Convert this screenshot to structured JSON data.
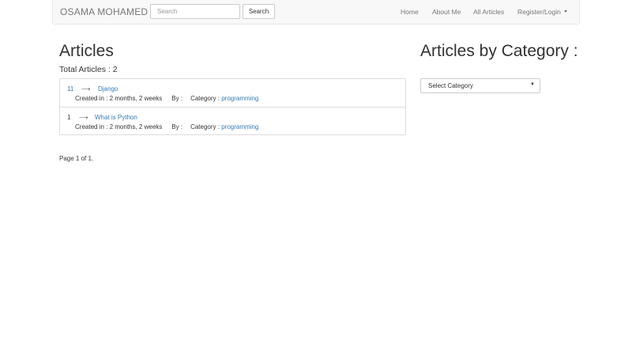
{
  "navbar": {
    "brand": "OSAMA MOHAMED",
    "search_placeholder": "Search",
    "search_button": "Search",
    "links": [
      "Home",
      "About Me",
      "All Articles",
      "Register/Login"
    ]
  },
  "articles": {
    "title": "Articles",
    "total": "Total Articles : 2",
    "items": [
      {
        "number": "11",
        "arrow": "⟶",
        "title": "Django",
        "created": "Created in : 2 months, 2 weeks",
        "by": "By :",
        "category_label": "Category :",
        "category": "programming"
      },
      {
        "number": "1",
        "arrow": "⟶",
        "title": "What is Python",
        "created": "Created in : 2 months, 2 weeks",
        "by": "By :",
        "category_label": "Category :",
        "category": "programming"
      }
    ],
    "pagination": "Page 1 of 1."
  },
  "sidebar": {
    "title": "Articles by Category :",
    "select_value": "Select Category"
  }
}
